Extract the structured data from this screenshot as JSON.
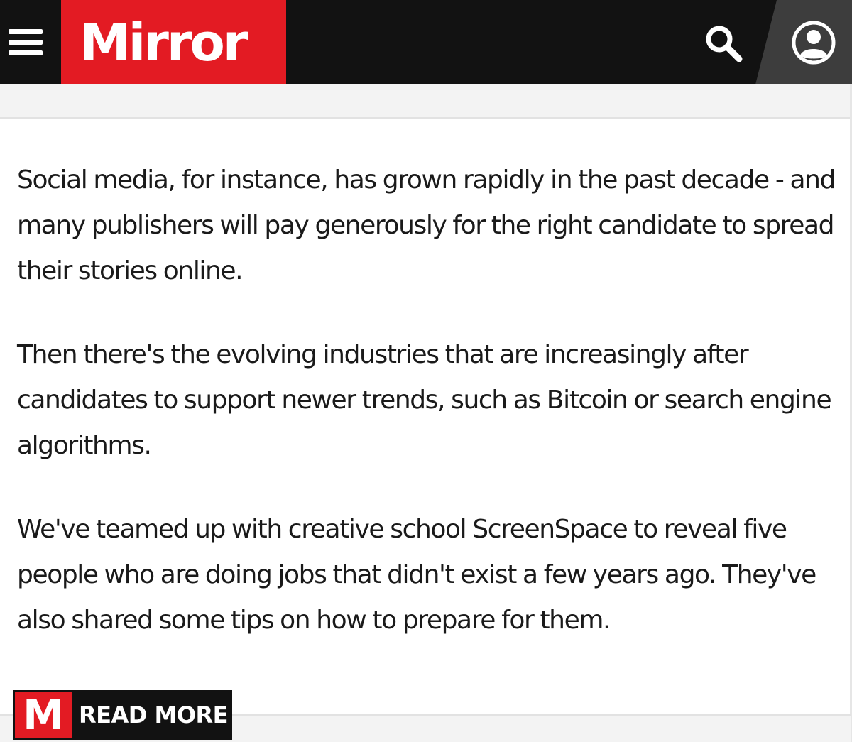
{
  "header": {
    "logo_text": "Mirror",
    "menu_icon": "hamburger-menu-icon",
    "search_icon": "search-icon",
    "account_icon": "user-account-icon",
    "brand_color": "#e31b23",
    "bar_color": "#121212"
  },
  "article": {
    "paragraphs": [
      "Social media, for instance, has grown rapidly in the past decade - and many publishers will pay generously for the right candidate to spread their stories online.",
      "Then there's the evolving industries that are increasingly after candidates to support newer trends, such as Bitcoin or search engine algorithms.",
      "We've teamed up with creative school ScreenSpace to reveal five people who are doing jobs that didn't exist a few years ago. They've also shared some tips on how to prepare for them."
    ]
  },
  "read_more": {
    "logo_letter": "M",
    "label": "READ MORE"
  }
}
